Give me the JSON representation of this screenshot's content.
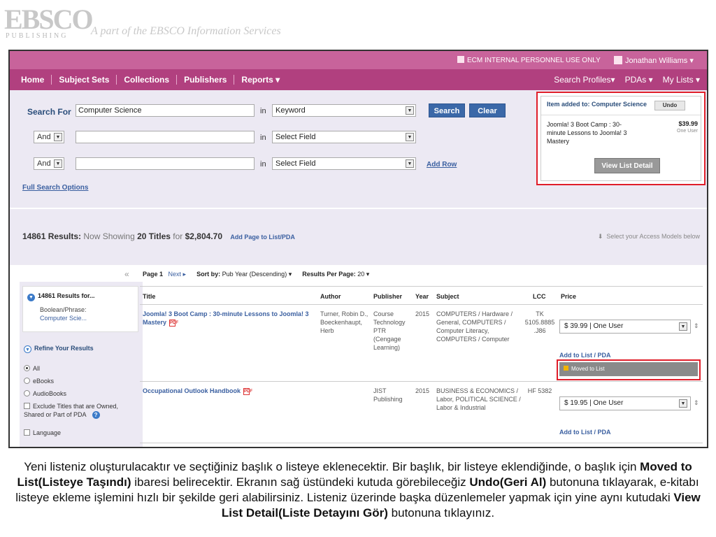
{
  "banner": {
    "logo_main": "EBSCO",
    "logo_sub": "PUBLISHING",
    "tagline": "A part of the EBSCO Information Services"
  },
  "utilbar": {
    "ecm_label": "ECM INTERNAL PERSONNEL USE ONLY",
    "user_name": "Jonathan Williams"
  },
  "nav": {
    "left": [
      "Home",
      "Subject Sets",
      "Collections",
      "Publishers",
      "Reports ▾"
    ],
    "right": [
      "Search Profiles▾",
      "PDAs ▾",
      "My Lists ▾"
    ]
  },
  "search": {
    "search_for_label": "Search For",
    "query_value": "Computer Science",
    "in_label": "in",
    "field1": "Keyword",
    "field2": "Select Field",
    "field3": "Select Field",
    "bool1": "And",
    "bool2": "And",
    "search_btn": "Search",
    "clear_btn": "Clear",
    "add_row": "Add Row",
    "full_options": "Full Search Options"
  },
  "popup": {
    "heading": "Item added to: Computer Science",
    "undo": "Undo",
    "item_title": "Joomla! 3 Boot Camp : 30-minute Lessons to Joomla! 3 Mastery",
    "item_price": "$39.99",
    "item_license": "One User",
    "view_btn": "View List Detail"
  },
  "results": {
    "count": "14861 Results:",
    "showing": "Now Showing",
    "titles": "20 Titles",
    "for": "for",
    "total": "$2,804.70",
    "add_page": "Add Page to List/PDA",
    "access": "Select your Access Models below"
  },
  "sidebar": {
    "results_for": "14861 Results for...",
    "bool_label": "Boolean/Phrase:",
    "bool_value": "Computer Scie...",
    "refine": "Refine Your Results",
    "options": [
      "All",
      "eBooks",
      "AudioBooks"
    ],
    "exclude": "Exclude Titles that are Owned, Shared or Part of PDA",
    "language": "Language"
  },
  "pager": {
    "page": "Page 1",
    "next": "Next ▸",
    "sort_label": "Sort by:",
    "sort_value": "Pub Year (Descending) ▾",
    "rpp_label": "Results Per Page:",
    "rpp_value": "20 ▾"
  },
  "table": {
    "headers": [
      "Title",
      "Author",
      "Publisher",
      "Year",
      "Subject",
      "LCC",
      "Price"
    ],
    "rows": [
      {
        "title": "Joomla! 3 Boot Camp : 30-minute Lessons to Joomla! 3 Mastery",
        "author": "Turner, Robin D., Boeckenhaupt, Herb",
        "publisher": "Course Technology PTR (Cengage Learning)",
        "year": "2015",
        "subject": "COMPUTERS / Hardware / General, COMPUTERS / Computer Literacy, COMPUTERS / Computer",
        "lcc": "TK 5105.8885 .J86",
        "price": "$ 39.99 | One User",
        "add": "Add to List / PDA",
        "status": "Moved to List"
      },
      {
        "title": "Occupational Outlook Handbook",
        "author": "",
        "publisher": "JIST Publishing",
        "year": "2015",
        "subject": "BUSINESS & ECONOMICS / Labor, POLITICAL SCIENCE / Labor & Industrial",
        "lcc": "HF 5382",
        "price": "$ 19.95 | One User",
        "add": "Add to List / PDA"
      }
    ]
  },
  "caption": {
    "p1": "Yeni listeniz oluşturulacaktır ve seçtiğiniz başlık o listeye eklenecektir. Bir başlık, bir listeye eklendiğinde, o başlık için ",
    "b1": "Moved to List(Listeye Taşındı)",
    "p2": " ibaresi belirecektir. Ekranın sağ üstündeki kutuda görebileceğiz ",
    "b2": "Undo(Geri Al)",
    "p3": " butonuna tıklayarak, e-kitabı listeye ekleme işlemini hızlı bir şekilde geri alabilirsiniz. Listeniz üzerinde başka düzenlemeler yapmak için yine aynı kutudaki ",
    "b3": "View List Detail(Liste Detayını Gör)",
    "p4": " butonuna tıklayınız."
  }
}
